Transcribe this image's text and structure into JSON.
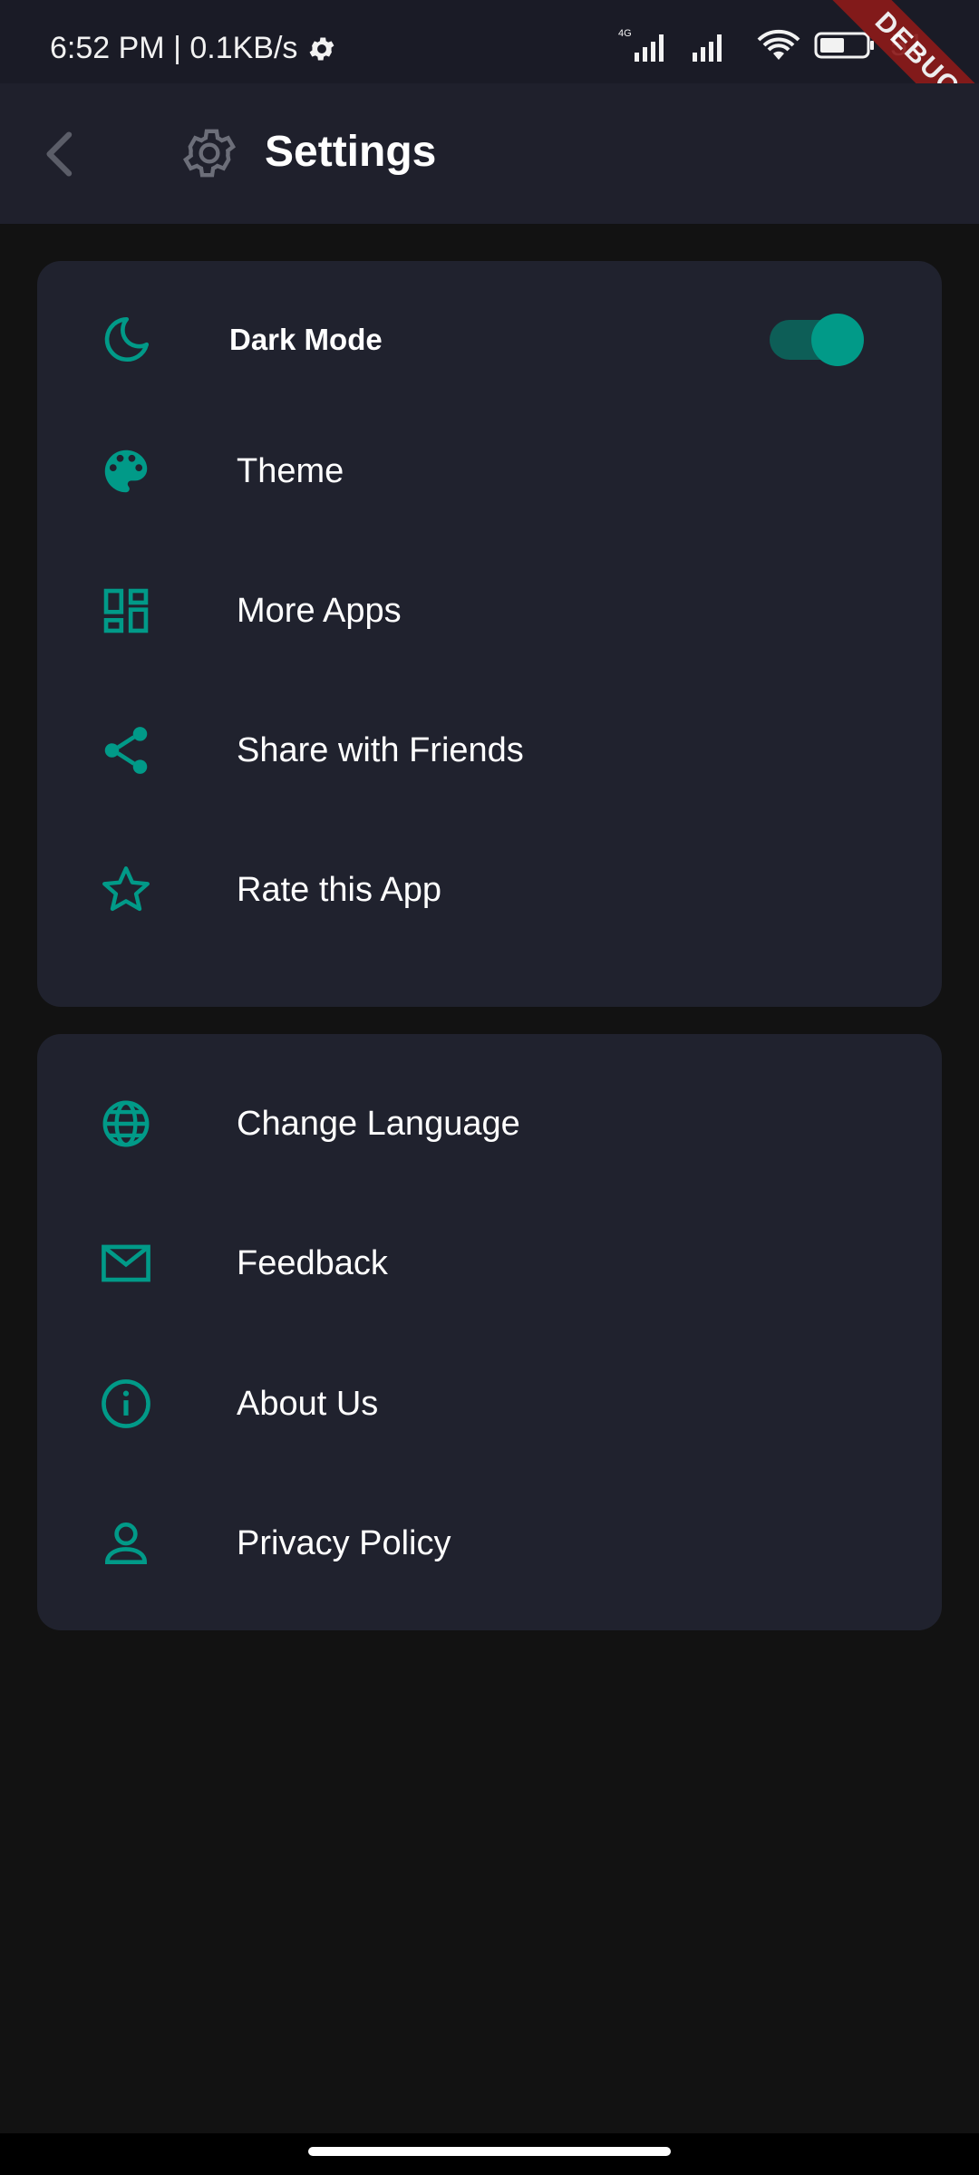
{
  "status_bar": {
    "time_speed": "6:52 PM | 0.1KB/s",
    "network_type": "4G",
    "battery_text": "51",
    "debug_banner": "DEBUG"
  },
  "app_bar": {
    "title": "Settings",
    "back_icon": "chevron-left-icon",
    "title_icon": "gear-icon"
  },
  "colors": {
    "accent": "#019a88",
    "card_bg": "#20222e",
    "page_bg": "#121212",
    "appbar_bg": "#1f202c"
  },
  "section1": {
    "dark_mode": {
      "label": "Dark Mode",
      "icon": "moon-icon",
      "enabled": true
    },
    "items": [
      {
        "label": "Theme",
        "icon": "palette-icon"
      },
      {
        "label": "More Apps",
        "icon": "dashboard-icon"
      },
      {
        "label": "Share with Friends",
        "icon": "share-icon"
      },
      {
        "label": "Rate this App",
        "icon": "star-icon"
      }
    ]
  },
  "section2": {
    "items": [
      {
        "label": "Change Language",
        "icon": "globe-icon"
      },
      {
        "label": "Feedback",
        "icon": "mail-icon"
      },
      {
        "label": "About Us",
        "icon": "info-icon"
      },
      {
        "label": "Privacy Policy",
        "icon": "person-icon"
      }
    ]
  }
}
